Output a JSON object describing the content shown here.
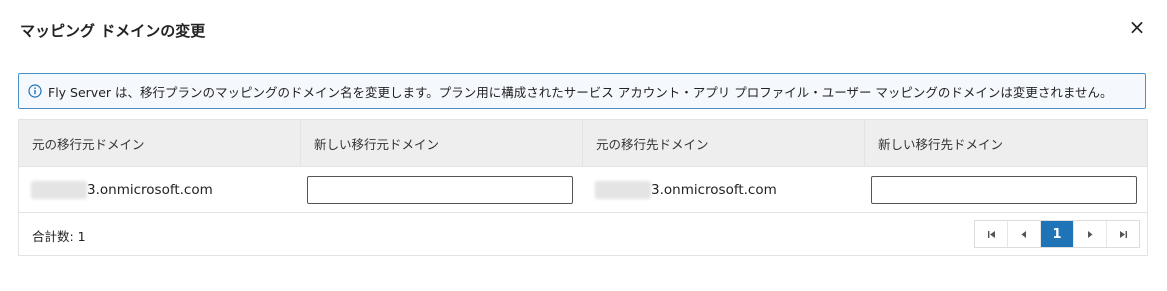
{
  "dialog": {
    "title": "マッピング ドメインの変更",
    "close_label": "×"
  },
  "info": {
    "icon": "info-icon",
    "message": "Fly Server は、移行プランのマッピングのドメイン名を変更します。プラン用に構成されたサービス アカウント・アプリ プロファイル・ユーザー マッピングのドメインは変更されません。"
  },
  "table": {
    "headers": [
      "元の移行元ドメイン",
      "新しい移行元ドメイン",
      "元の移行先ドメイン",
      "新しい移行先ドメイン"
    ],
    "rows": [
      {
        "source_domain": "3.onmicrosoft.com",
        "new_source_domain": "",
        "destination_domain": "3.onmicrosoft.com",
        "new_destination_domain": ""
      }
    ]
  },
  "footer": {
    "total_label": "合計数: 1"
  },
  "pagination": {
    "first": "⏮",
    "prev": "◀",
    "current_page": "1",
    "next": "▶",
    "last": "⏭"
  },
  "colors": {
    "accent": "#1f73b7",
    "info_border": "#4a8fc7",
    "header_bg": "#eeeeee"
  }
}
